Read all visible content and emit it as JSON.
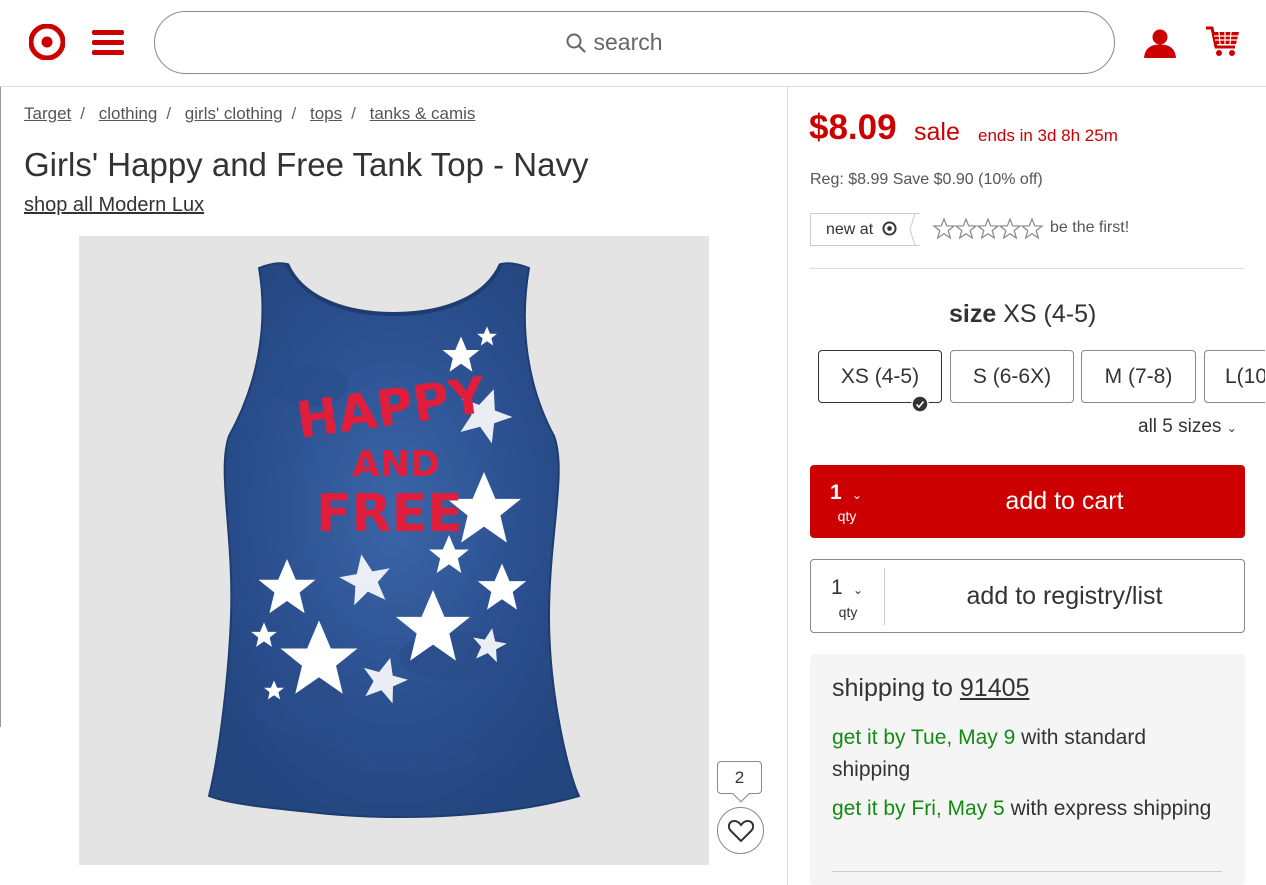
{
  "header": {
    "search_placeholder": "search",
    "brand_color": "#cc0000"
  },
  "breadcrumb": [
    "Target",
    "clothing",
    "girls' clothing",
    "tops",
    "tanks & camis"
  ],
  "product": {
    "title": "Girls' Happy and Free Tank Top - Navy",
    "shop_all": "shop all Modern Lux",
    "favorites_count": "2",
    "image_text": [
      "HAPPY",
      "AND",
      "FREE"
    ]
  },
  "pricing": {
    "price": "$8.09",
    "sale": "sale",
    "ends": "ends in 3d 8h 25m",
    "regular": "Reg: $8.99 Save $0.90 (10% off)"
  },
  "rating": {
    "new_at": "new at",
    "be_first": "be the first!",
    "stars_filled": 0,
    "stars_total": 5
  },
  "size": {
    "label": "size",
    "selected": "XS (4-5)",
    "options": [
      "XS (4-5)",
      "S (6-6X)",
      "M (7-8)",
      "L(10"
    ],
    "all_sizes": "all 5 sizes"
  },
  "cart": {
    "qty": "1",
    "qty_label": "qty",
    "add_to_cart": "add to cart",
    "add_to_registry": "add to registry/list"
  },
  "shipping": {
    "heading": "shipping to",
    "zip": "91405",
    "standard_date": "get it by Tue, May 9",
    "standard_rest": "with standard shipping",
    "express_date": "get it by Fri, May 5",
    "express_rest": "with express shipping"
  }
}
